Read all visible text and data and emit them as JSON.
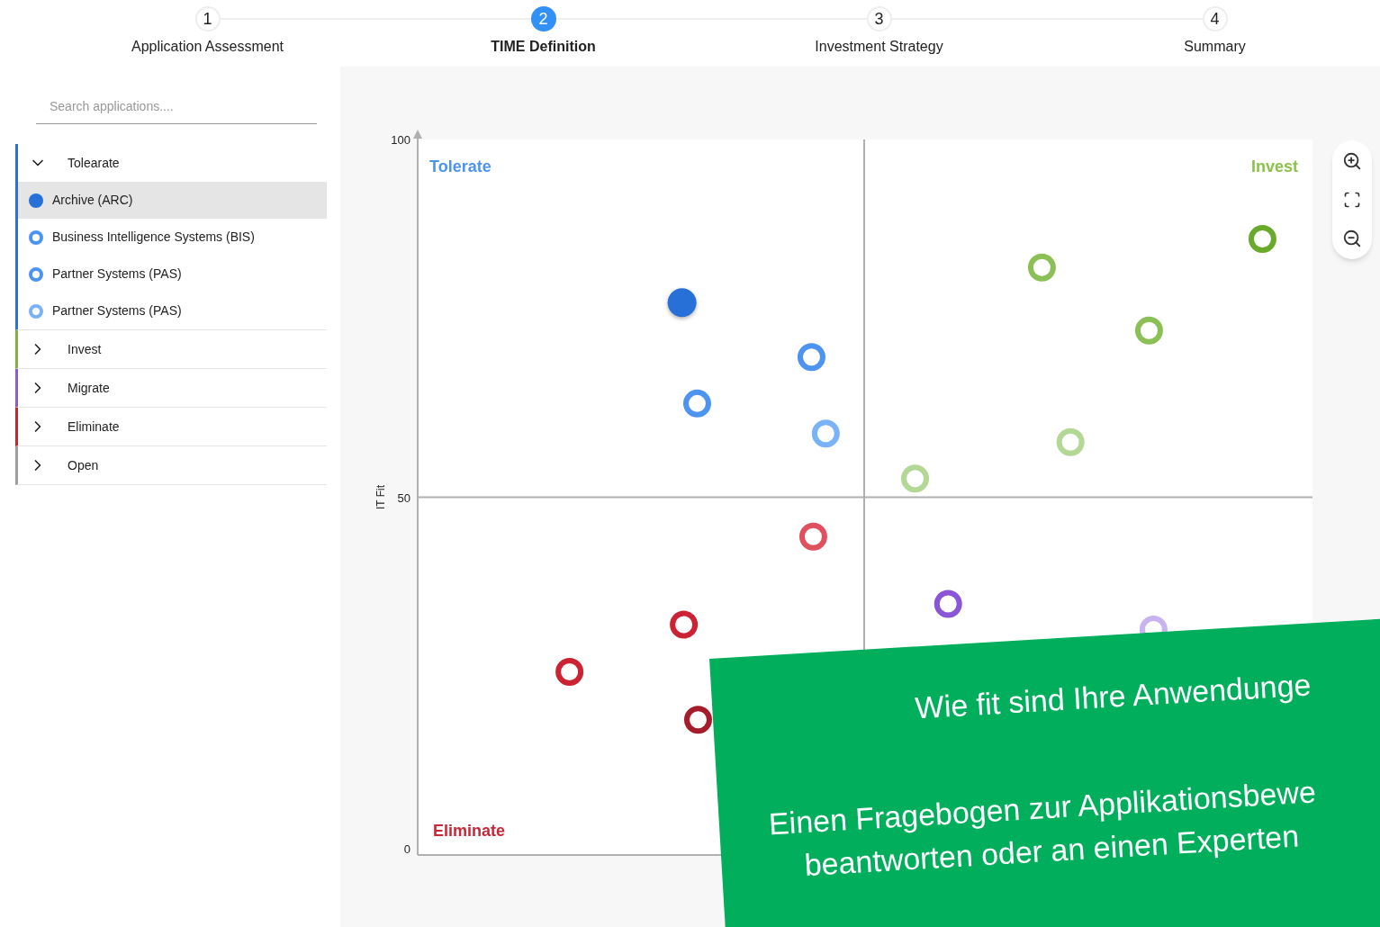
{
  "steps": [
    {
      "number": "1",
      "label": "Application Assessment",
      "selected": false
    },
    {
      "number": "2",
      "label": "TIME Definition",
      "selected": true
    },
    {
      "number": "3",
      "label": "Investment Strategy",
      "selected": false
    },
    {
      "number": "4",
      "label": "Summary",
      "selected": false
    }
  ],
  "search": {
    "placeholder": "Search applications...."
  },
  "groups": [
    {
      "label": "Tolearate",
      "color": "#2f6fdc",
      "expanded": true,
      "children": [
        {
          "label": "Archive (ARC)",
          "color": "#2670d8",
          "selected": true
        },
        {
          "label": "Business Intelligence Systems (BIS)",
          "color": "#4d94f0",
          "selected": false
        },
        {
          "label": "Partner Systems (PAS)",
          "color": "#4d94f0",
          "selected": false
        },
        {
          "label": "Partner Systems (PAS)",
          "color": "#7ab2f7",
          "selected": false
        }
      ]
    },
    {
      "label": "Invest",
      "color": "#7cb342",
      "expanded": false
    },
    {
      "label": "Migrate",
      "color": "#8e5bd6",
      "expanded": false
    },
    {
      "label": "Eliminate",
      "color": "#c62828",
      "expanded": false
    },
    {
      "label": "Open",
      "color": "#9e9e9e",
      "expanded": false
    }
  ],
  "chart": {
    "quadrants": [
      {
        "label": "Tolerate",
        "color": "#4d94f0",
        "kind": "top-left"
      },
      {
        "label": "Invest",
        "color": "#8bc34a",
        "kind": "top-right"
      },
      {
        "label": "Eliminate",
        "color": "#c62839",
        "kind": "bottom-left"
      }
    ],
    "y_axis": {
      "label": "IT Fit",
      "ticks": [
        {
          "label": "100",
          "kind": "top"
        },
        {
          "label": "50",
          "kind": "middle"
        },
        {
          "label": "0",
          "kind": "bottom"
        }
      ]
    }
  },
  "banner": {
    "lines": [
      "Wie fit sind Ihre Anwendunge",
      "Einen Fragebogen zur Applikationsbewe",
      "beantworten oder an einen Experten"
    ]
  }
}
